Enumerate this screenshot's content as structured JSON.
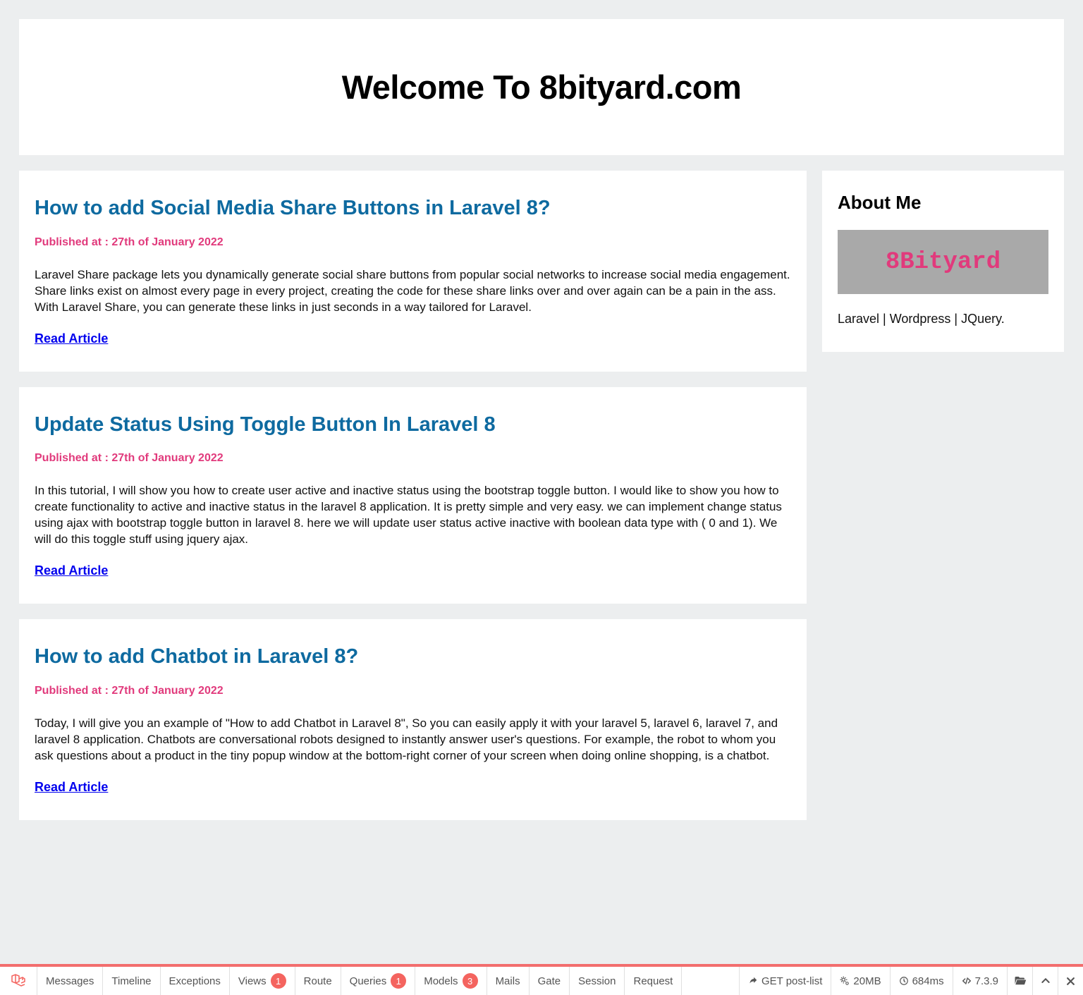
{
  "header": {
    "title": "Welcome To 8bityard.com"
  },
  "posts": [
    {
      "title": "How to add Social Media Share Buttons in Laravel 8?",
      "published": "Published at : 27th of January 2022",
      "body": "Laravel Share package lets you dynamically generate social share buttons from popular social networks to increase social media engagement. Share links exist on almost every page in every project, creating the code for these share links over and over again can be a pain in the ass. With Laravel Share, you can generate these links in just seconds in a way tailored for Laravel.",
      "read_label": "Read Article"
    },
    {
      "title": "Update Status Using Toggle Button In Laravel 8",
      "published": "Published at : 27th of January 2022",
      "body": "In this tutorial, I will show you how to create user active and inactive status using the bootstrap toggle button. I would like to show you how to create functionality to active and inactive status in the laravel 8 application. It is pretty simple and very easy. we can implement change status using ajax with bootstrap toggle button in laravel 8. here we will update user status active inactive with boolean data type with ( 0 and 1). We will do this toggle stuff using jquery ajax.",
      "read_label": "Read Article"
    },
    {
      "title": "How to add Chatbot in Laravel 8?",
      "published": "Published at : 27th of January 2022",
      "body": "Today, I will give you an example of \"How to add Chatbot in Laravel 8\", So you can easily apply it with your laravel 5, laravel 6, laravel 7, and laravel 8 application. Chatbots are conversational robots designed to instantly answer user's questions. For example, the robot to whom you ask questions about a product in the tiny popup window at the bottom-right corner of your screen when doing online shopping, is a chatbot.",
      "read_label": "Read Article"
    }
  ],
  "sidebar": {
    "title": "About Me",
    "banner_text": "8Bityard",
    "desc": "Laravel | Wordpress | JQuery."
  },
  "debugbar": {
    "tabs": {
      "messages": "Messages",
      "timeline": "Timeline",
      "exceptions": "Exceptions",
      "views": "Views",
      "views_badge": "1",
      "route": "Route",
      "queries": "Queries",
      "queries_badge": "1",
      "models": "Models",
      "models_badge": "3",
      "mails": "Mails",
      "gate": "Gate",
      "session": "Session",
      "request": "Request"
    },
    "status": {
      "route": "GET post-list",
      "memory": "20MB",
      "time": "684ms",
      "version": "7.3.9"
    }
  }
}
